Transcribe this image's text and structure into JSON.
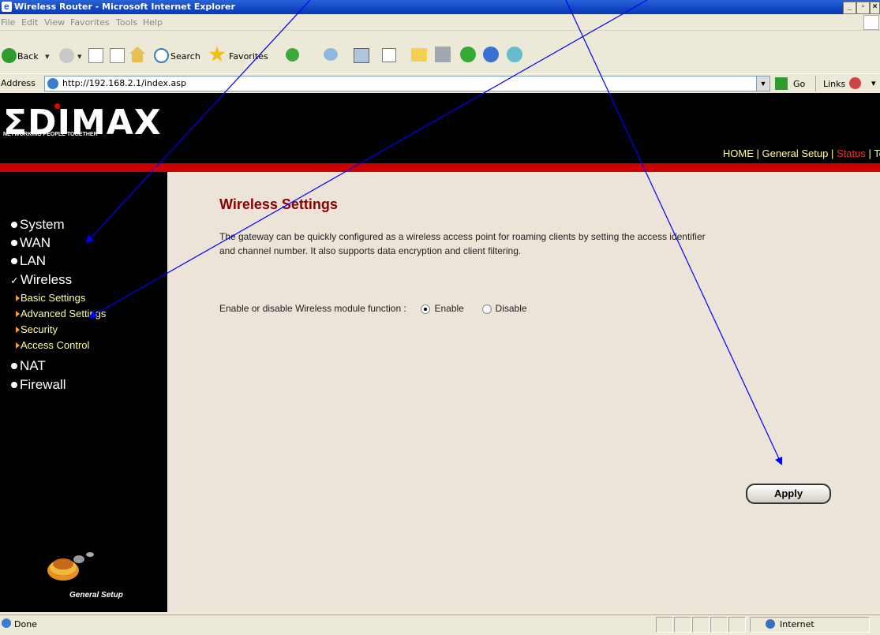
{
  "window": {
    "title": "Wireless Router - Microsoft Internet Explorer",
    "buttons": [
      "_",
      "F",
      "X"
    ]
  },
  "menu": [
    "File",
    "Edit",
    "View",
    "Favorites",
    "Tools",
    "Help"
  ],
  "toolbar": {
    "back_label": "Back",
    "search_label": "Search",
    "favorites_label": "Favorites"
  },
  "address": {
    "label": "Address",
    "url": "http://192.168.2.1/index.asp",
    "go_label": "Go",
    "links_label": "Links"
  },
  "header": {
    "logo": "ΣDIMAX",
    "tagline": "NETWORKING PEOPLE TOGETHER",
    "nav": {
      "home": "HOME",
      "sep1": "|",
      "general": "General Setup",
      "sep2": "|",
      "status": "Status",
      "sep3": "|",
      "tools": "To"
    }
  },
  "sidebar": {
    "items": [
      {
        "label": "System"
      },
      {
        "label": "WAN"
      },
      {
        "label": "LAN"
      },
      {
        "label": "Wireless"
      },
      {
        "label": "NAT"
      },
      {
        "label": "Firewall"
      }
    ],
    "subitems": [
      {
        "label": "Basic Settings"
      },
      {
        "label": "Advanced Settings"
      },
      {
        "label": "Security"
      },
      {
        "label": "Access Control"
      }
    ],
    "footer_label": "General Setup"
  },
  "main": {
    "heading": "Wireless Settings",
    "description_line1": "The gateway can be quickly configured as a wireless access point for roaming clients by setting the access identifier",
    "description_line2": "and channel number. It also supports data encryption and client filtering.",
    "module_label": "Enable or disable Wireless module function :",
    "enable_label": "Enable",
    "disable_label": "Disable",
    "selected": "Enable",
    "apply_label": "Apply"
  },
  "status": {
    "text": "Done",
    "zone": "Internet"
  },
  "colors": {
    "annotation_arrow": "#0000ff",
    "heading": "#8b0000",
    "stripe": "#cc0000"
  }
}
